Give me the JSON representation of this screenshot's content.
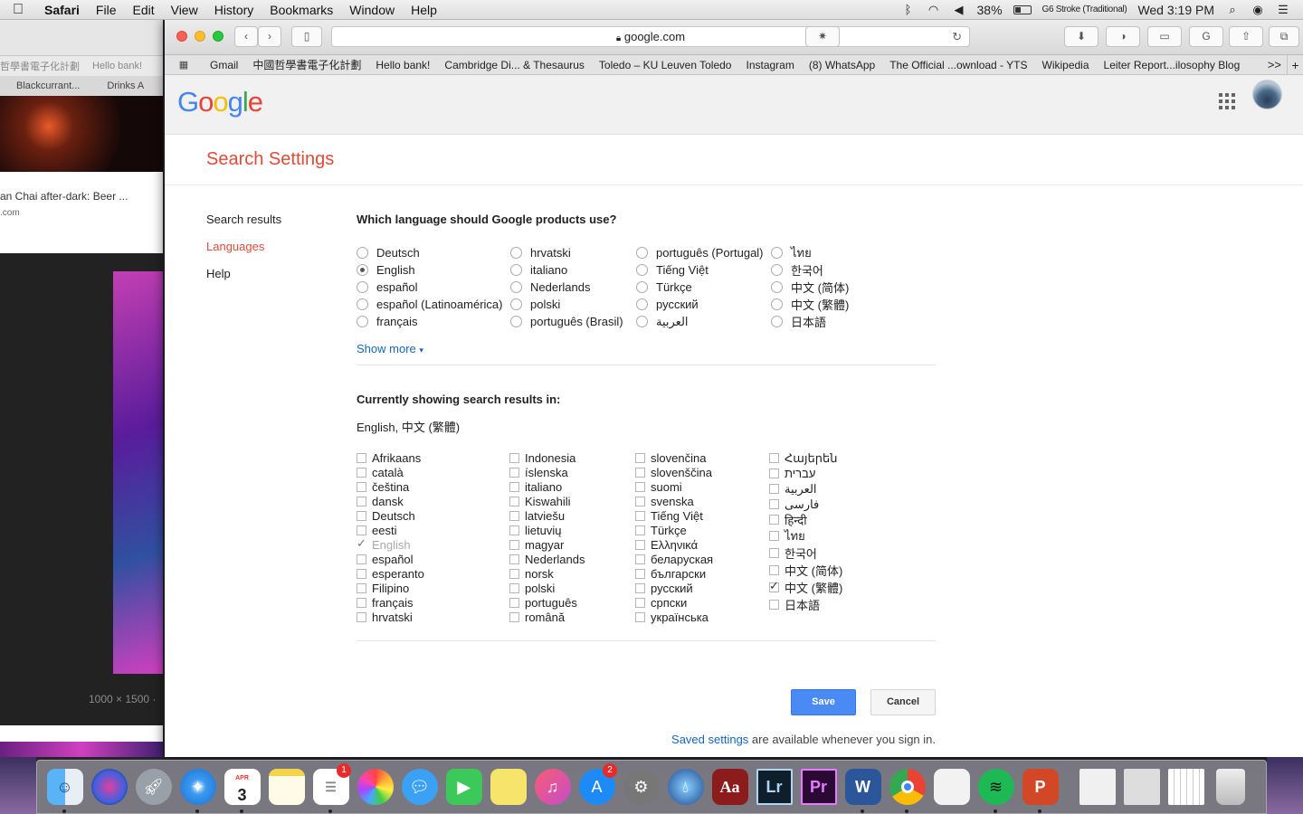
{
  "menubar": {
    "app": "Safari",
    "items": [
      "File",
      "Edit",
      "View",
      "History",
      "Bookmarks",
      "Window",
      "Help"
    ],
    "battery": "38%",
    "input_method": "G6 Stroke (Traditional)",
    "clock": "Wed 3:19 PM"
  },
  "background_window": {
    "favorites": [
      "哲學書電子化計劃",
      "Hello bank!"
    ],
    "tabs": [
      "Blackcurrant...",
      "Drinks A"
    ],
    "card_title": "an Chai after-dark: Beer ...",
    "card_sub": ".com",
    "image_dims": "1000 × 1500 ·"
  },
  "browser": {
    "url": "google.com",
    "bookmarks": [
      "Gmail",
      "中國哲學書電子化計劃",
      "Hello bank!",
      "Cambridge Di... & Thesaurus",
      "Toledo – KU Leuven Toledo",
      "Instagram",
      "(8) WhatsApp",
      "The Official ...ownload - YTS",
      "Wikipedia",
      "Leiter Report...ilosophy Blog"
    ],
    "more_bookmarks": ">>",
    "new_tab": "+"
  },
  "google": {
    "logo": "Google",
    "page_title": "Search Settings",
    "nav": {
      "search_results": "Search results",
      "languages": "Languages",
      "help": "Help"
    },
    "question": "Which language should Google products use?",
    "product_languages": [
      [
        "Deutsch",
        "English",
        "español",
        "español (Latinoamérica)",
        "français"
      ],
      [
        "hrvatski",
        "italiano",
        "Nederlands",
        "polski",
        "português (Brasil)"
      ],
      [
        "português (Portugal)",
        "Tiếng Việt",
        "Türkçe",
        "русский",
        "العربية"
      ],
      [
        "ไทย",
        "한국어",
        "中文 (简体)",
        "中文 (繁體)",
        "日本語"
      ]
    ],
    "selected_product_language": "English",
    "show_more": "Show more",
    "results_heading": "Currently showing search results in:",
    "results_current": "English, 中文 (繁體)",
    "result_languages": [
      [
        "Afrikaans",
        "català",
        "čeština",
        "dansk",
        "Deutsch",
        "eesti",
        "English",
        "español",
        "esperanto",
        "Filipino",
        "français",
        "hrvatski"
      ],
      [
        "Indonesia",
        "íslenska",
        "italiano",
        "Kiswahili",
        "latviešu",
        "lietuvių",
        "magyar",
        "Nederlands",
        "norsk",
        "polski",
        "português",
        "română"
      ],
      [
        "slovenčina",
        "slovenščina",
        "suomi",
        "svenska",
        "Tiếng Việt",
        "Türkçe",
        "Ελληνικά",
        "беларуская",
        "български",
        "русский",
        "српски",
        "українська"
      ],
      [
        "Հայերեն",
        "עברית",
        "العربية",
        "فارسی",
        "हिन्दी",
        "ไทย",
        "한국어",
        "中文 (简体)",
        "中文 (繁體)",
        "日本語"
      ]
    ],
    "checked_result_languages": [
      "English",
      "中文 (繁體)"
    ],
    "save": "Save",
    "cancel": "Cancel",
    "saved_link": "Saved settings",
    "saved_text": " are available whenever you sign in."
  },
  "dock": {
    "calendar_month": "APR",
    "calendar_day": "3",
    "reminders_badge": "1",
    "appstore_badge": "2",
    "dictionary_label": "Aa",
    "lightroom_label": "Lr",
    "premiere_label": "Pr",
    "word_label": "W",
    "powerpoint_label": "P"
  }
}
